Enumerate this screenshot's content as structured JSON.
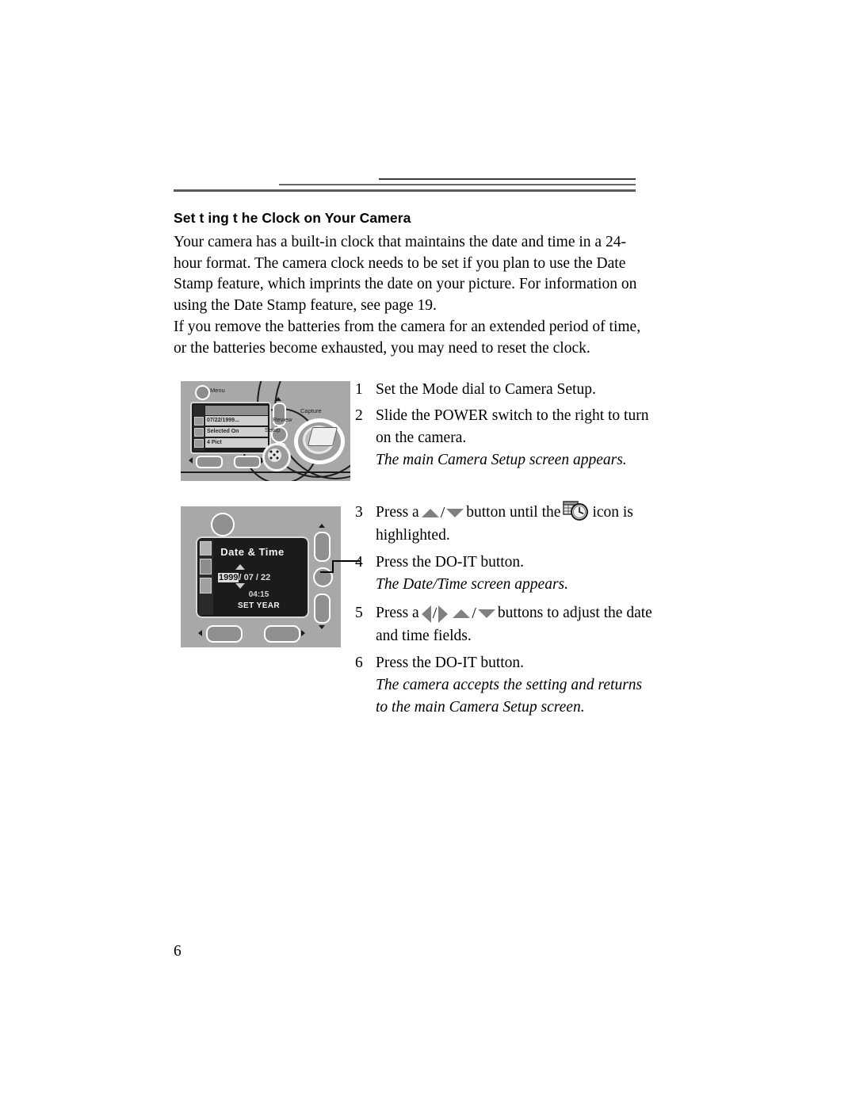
{
  "page": {
    "number": "6",
    "heading": "Set t ing t he Clock on Your Camera",
    "paragraphs": [
      "Your camera has a built-in clock that maintains the date and time in a 24-hour format. The camera clock needs to be set if you plan to use the Date Stamp feature, which imprints the date on your picture. For information on using the Date Stamp feature, see page 19.",
      "If you remove the batteries from the camera for an extended period of time, or the batteries become exhausted, you may need to reset the clock."
    ]
  },
  "steps": [
    {
      "number": "1",
      "text": "Set the Mode dial to Camera Setup.",
      "result": ""
    },
    {
      "number": "2",
      "text": "Slide the POWER switch to the right to turn on the camera.",
      "result": "The main Camera Setup screen appears."
    },
    {
      "number": "3",
      "text_before": "Press a",
      "text_middle": "button until the",
      "text_after": "icon is highlighted.",
      "icons": [
        "triangle-up-icon",
        "triangle-down-icon",
        "date-time-calendar-clock-icon"
      ],
      "result": ""
    },
    {
      "number": "4",
      "text": "Press the DO-IT button.",
      "result": "The Date/Time screen appears."
    },
    {
      "number": "5",
      "text_before": "Press a",
      "text_after": "buttons to adjust the date and time fields.",
      "icons": [
        "triangle-left-icon",
        "triangle-right-icon",
        "triangle-up-icon",
        "triangle-down-icon"
      ],
      "result": ""
    },
    {
      "number": "6",
      "text": "Press the DO-IT button.",
      "result": "The camera accepts the setting and returns to the main Camera Setup screen."
    }
  ],
  "figure_setup": {
    "caption_hidden": "Camera back showing LCD with Camera Setup menu and Mode dial",
    "menu_label": "Menu",
    "lcd_rows": [
      "",
      "07/22/1999...",
      "Selected On",
      "4 Pict"
    ],
    "dial_labels": {
      "capture": "Capture",
      "review": "Review",
      "setup": "Setup"
    }
  },
  "figure_datetime": {
    "caption_hidden": "Camera back showing the Date & Time screen",
    "lcd_title": "Date & Time",
    "lcd_year": "1999",
    "lcd_date_rest": "/ 07 / 22",
    "lcd_time": "04:15",
    "lcd_prompt": "SET YEAR",
    "callout_number": "4"
  },
  "colors": {
    "page_background": "#ffffff",
    "text": "#000000",
    "figure_background": "#a8a8a8",
    "lcd_background": "#1b1b1b",
    "lcd_text": "#f2f2f2",
    "arrow_glyph": "#808080",
    "rule": "#5a5a5a"
  }
}
